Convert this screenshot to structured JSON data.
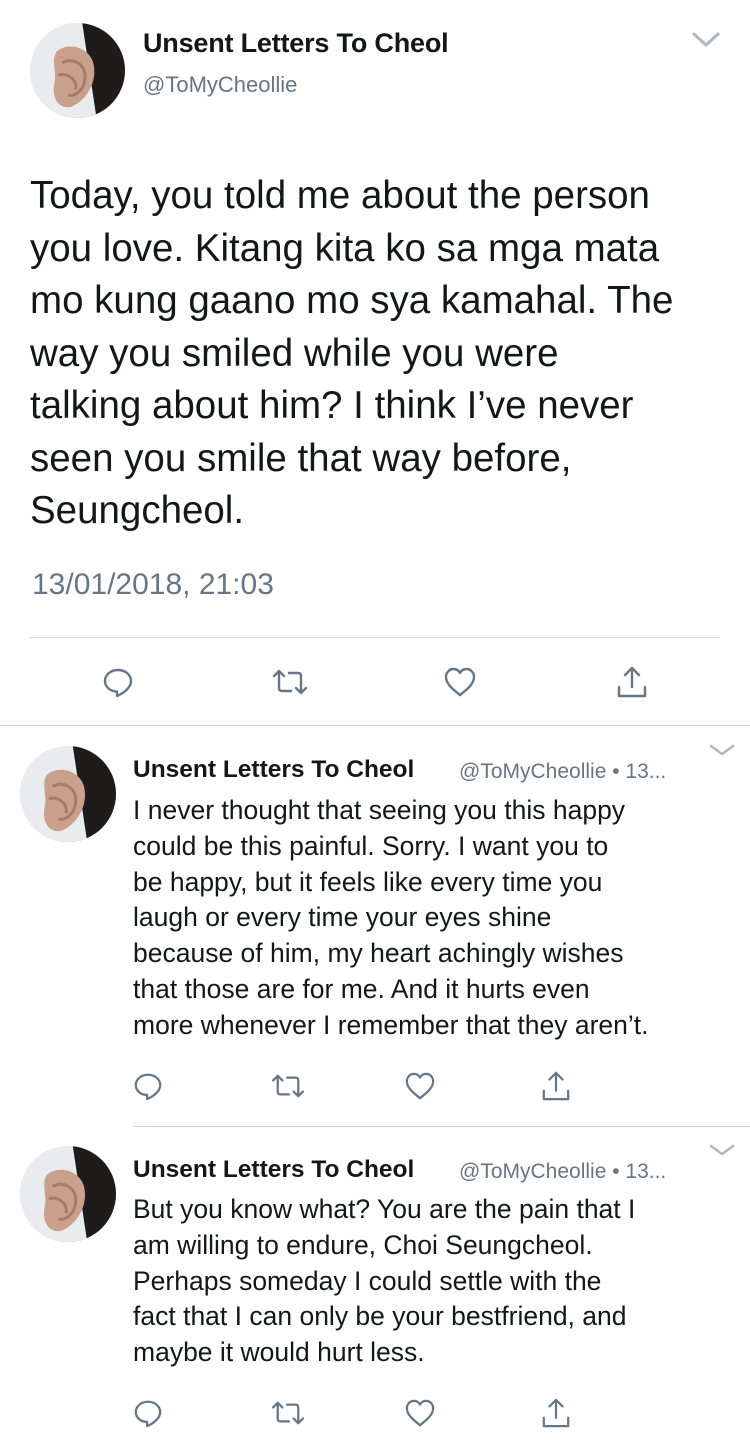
{
  "main_tweet": {
    "display_name": "Unsent Letters To Cheol",
    "handle": "@ToMyCheollie",
    "text_lines": [
      "Today, you told me about the person",
      "you love. Kitang kita ko sa mga mata",
      "mo kung gaano mo sya kamahal. The",
      "way you smiled while you were",
      "talking about him? I think I’ve never",
      "seen you smile that way before,",
      "Seungcheol."
    ],
    "timestamp": "13/01/2018, 21:03"
  },
  "replies": [
    {
      "display_name": "Unsent Letters To Cheol",
      "meta": "@ToMyCheollie • 13...",
      "text_lines": [
        "I never thought that seeing you this happy",
        "could be this painful. Sorry. I want you to",
        "be happy, but it feels like every time you",
        "laugh or every time your eyes shine",
        "because of him, my heart achingly wishes",
        "that those are for me. And it hurts even",
        "more whenever I remember that they aren’t."
      ]
    },
    {
      "display_name": "Unsent Letters To Cheol",
      "meta": "@ToMyCheollie • 13...",
      "text_lines": [
        "But you know what? You are the pain that I",
        "am willing to endure, Choi Seungcheol.",
        "Perhaps someday I could settle with the",
        "fact that I can only be your bestfriend, and",
        "maybe it would hurt less."
      ]
    }
  ],
  "icons": {
    "reply": "reply-icon",
    "retweet": "retweet-icon",
    "like": "like-icon",
    "share": "share-icon",
    "menu": "chevron-down-icon"
  },
  "colors": {
    "text": "#14171a",
    "secondary": "#657786",
    "divider": "#d5dadd"
  }
}
